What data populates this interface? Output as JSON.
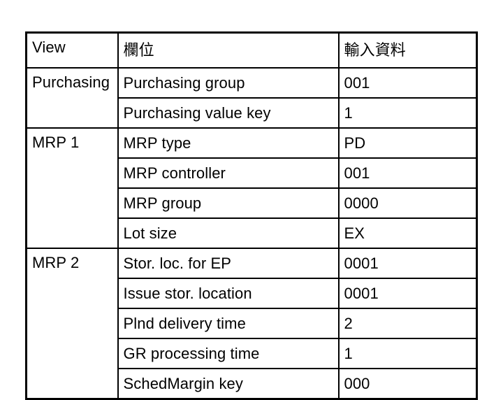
{
  "table": {
    "name": "material-master-view-table",
    "columns": [
      {
        "key": "view",
        "header": "View"
      },
      {
        "key": "field",
        "header": "欄位"
      },
      {
        "key": "input",
        "header": "輸入資料"
      }
    ],
    "groups": [
      {
        "view": "Purchasing",
        "rows": [
          {
            "field": "Purchasing group",
            "input": "001"
          },
          {
            "field": "Purchasing value key",
            "input": "1"
          }
        ]
      },
      {
        "view": "MRP 1",
        "rows": [
          {
            "field": "MRP type",
            "input": "PD"
          },
          {
            "field": "MRP controller",
            "input": "001"
          },
          {
            "field": "MRP group",
            "input": "0000"
          },
          {
            "field": "Lot size",
            "input": "EX"
          }
        ]
      },
      {
        "view": "MRP 2",
        "rows": [
          {
            "field": "Stor. loc. for EP",
            "input": "0001"
          },
          {
            "field": "Issue stor. location",
            "input": "0001"
          },
          {
            "field": "Plnd delivery time",
            "input": "2"
          },
          {
            "field": "GR processing time",
            "input": "1"
          },
          {
            "field": "SchedMargin key",
            "input": "000"
          }
        ]
      }
    ],
    "colors": {
      "border": "#000000",
      "text": "#000000",
      "background": "#ffffff"
    }
  }
}
